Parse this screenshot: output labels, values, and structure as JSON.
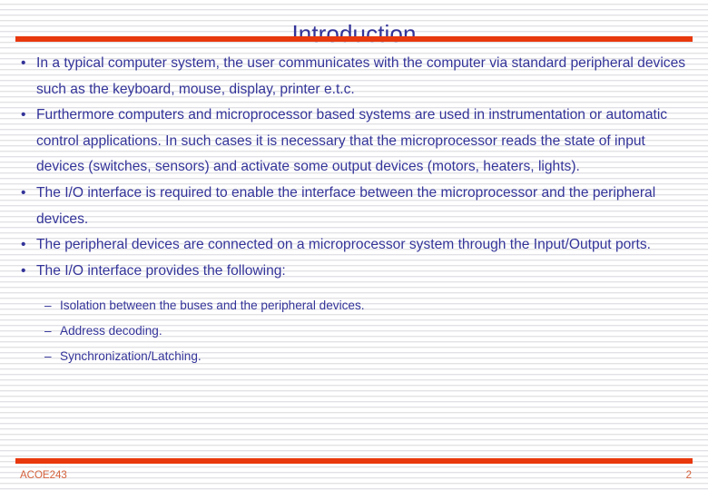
{
  "slide": {
    "title": "Introduction",
    "colors": {
      "text": "#333399",
      "accent_rule": "#e8380d",
      "footer_text": "#d4613c",
      "background": "#ffffff",
      "stripe": "#e2e2e6"
    },
    "bullets": [
      {
        "marker": "•",
        "text": "In a typical computer system, the user communicates with the computer via standard peripheral devices such as the keyboard, mouse, display, printer e.t.c."
      },
      {
        "marker": "•",
        "text": "Furthermore computers and microprocessor based systems are used in instrumentation or automatic control applications. In such cases it is necessary that the microprocessor reads the state of input devices (switches, sensors) and activate some output devices (motors, heaters, lights)."
      },
      {
        "marker": "•",
        "text": "The I/O interface is required to enable the interface between the microprocessor and the peripheral devices."
      },
      {
        "marker": "•",
        "text": "The peripheral devices are connected on a microprocessor system through the Input/Output ports."
      },
      {
        "marker": "•",
        "text": "The I/O interface provides the following:"
      }
    ],
    "sub_bullets": [
      {
        "marker": "–",
        "text": "Isolation between the buses and the peripheral devices."
      },
      {
        "marker": "–",
        "text": "Address decoding."
      },
      {
        "marker": "–",
        "text": "Synchronization/Latching."
      }
    ],
    "footer": {
      "label": "ACOE243",
      "page_number": "2"
    }
  }
}
